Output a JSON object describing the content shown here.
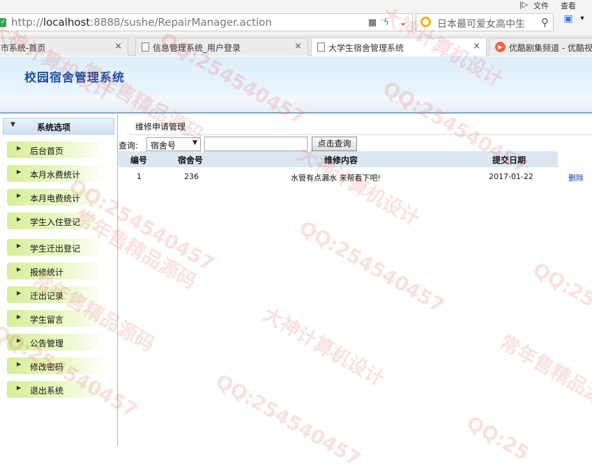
{
  "browser": {
    "menu": [
      "文件",
      "查看"
    ],
    "url_prefix": "http://",
    "url_host": "localhost",
    "url_rest": ":8888/sushe/RepairManager.action",
    "search_text": "日本最可爱女高中生",
    "tabs": [
      {
        "label": "市系统-首页",
        "active": false
      },
      {
        "label": "信息管理系统_用户登录",
        "active": false
      },
      {
        "label": "大学生宿舍管理系统",
        "active": true
      },
      {
        "label": "优酷剧集频道 - 优酷视频",
        "active": false
      }
    ]
  },
  "app": {
    "title": "校园宿舍管理系统"
  },
  "sidebar": {
    "header": "系统选项",
    "items": [
      {
        "label": "后台首页"
      },
      {
        "label": "本月水费统计"
      },
      {
        "label": "本月电费统计"
      },
      {
        "label": "学生入住登记"
      },
      {
        "label": "学生迁出登记"
      },
      {
        "label": "报修统计"
      },
      {
        "label": "迁出记录"
      },
      {
        "label": "学生留言"
      },
      {
        "label": "公告管理"
      },
      {
        "label": "修改密码"
      },
      {
        "label": "退出系统"
      }
    ]
  },
  "main": {
    "panel_title": "维修申请管理",
    "query_label": "查询:",
    "select_value": "宿舍号",
    "search_input_value": "",
    "search_button": "点击查询",
    "columns": [
      "编号",
      "宿舍号",
      "维修内容",
      "提交日期"
    ],
    "rows": [
      {
        "id": "1",
        "room": "236",
        "content": "水管有点漏水 来帮看下吧!",
        "date": "2017-01-22",
        "action": "删除"
      }
    ]
  },
  "watermark": [
    "大神计算机设计",
    "QQ:254540457",
    "常年售精品源码",
    "QQ:254540457",
    "大神计算机设计",
    "常年售精品源码",
    "QQ:254540457",
    "大神计算机设计",
    "QQ:254540457",
    "常年售精品源码",
    "QQ:254540457",
    "常年售精品源码",
    "QQ:25",
    "QQ:25",
    "QQ:254540457",
    "大神计算机设计"
  ]
}
